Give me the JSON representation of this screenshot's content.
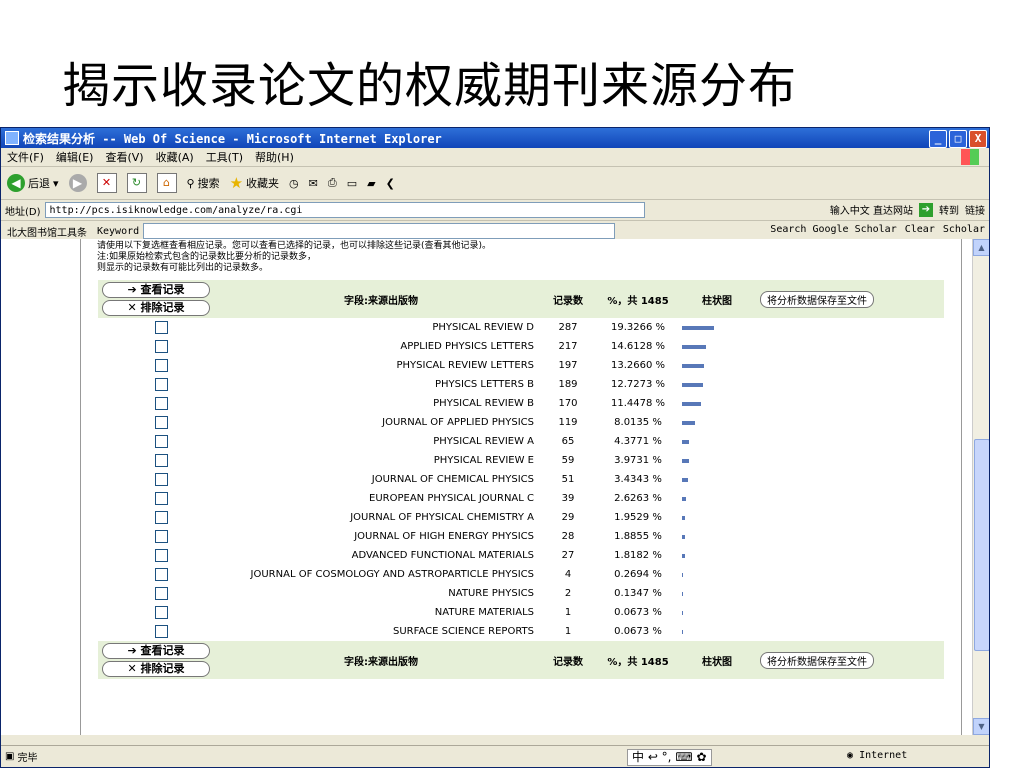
{
  "slide": {
    "title": "揭示收录论文的权威期刊来源分布"
  },
  "window": {
    "title": "检索结果分析 -- Web Of Science - Microsoft Internet Explorer",
    "controls": [
      "_",
      "□",
      "X"
    ]
  },
  "menu": [
    "文件(F)",
    "编辑(E)",
    "查看(V)",
    "收藏(A)",
    "工具(T)",
    "帮助(H)"
  ],
  "toolbar": {
    "back": "后退",
    "search": "搜索",
    "favorites": "收藏夹"
  },
  "address": {
    "label": "地址(D)",
    "url": "http://pcs.isiknowledge.com/analyze/ra.cgi",
    "hint": "输入中文 直达网站",
    "go": "转到",
    "links": "链接"
  },
  "libbar": {
    "label": "北大图书馆工具条",
    "keyword": "Keyword",
    "scholar": "Search Google Scholar",
    "clear": "Clear",
    "scholar2": "Scholar"
  },
  "notes": [
    "请使用以下复选框查看相应记录。您可以查看已选择的记录，也可以排除这些记录(查看其他记录)。",
    "注:如果原始检索式包含的记录数比要分析的记录数多，",
    "则显示的记录数有可能比列出的记录数多。"
  ],
  "table": {
    "view_btn": "➔ 查看记录",
    "exclude_btn": "✕ 排除记录",
    "field_header": "字段:来源出版物",
    "count_header": "记录数",
    "pct_header": "%，共 1485",
    "bar_header": "柱状图",
    "save_btn": "将分析数据保存至文件",
    "rows": [
      {
        "name": "PHYSICAL REVIEW D",
        "count": "287",
        "pct": "19.3266 %",
        "share": 19.3266
      },
      {
        "name": "APPLIED PHYSICS LETTERS",
        "count": "217",
        "pct": "14.6128 %",
        "share": 14.6128
      },
      {
        "name": "PHYSICAL REVIEW LETTERS",
        "count": "197",
        "pct": "13.2660 %",
        "share": 13.266
      },
      {
        "name": "PHYSICS LETTERS B",
        "count": "189",
        "pct": "12.7273 %",
        "share": 12.7273
      },
      {
        "name": "PHYSICAL REVIEW B",
        "count": "170",
        "pct": "11.4478 %",
        "share": 11.4478
      },
      {
        "name": "JOURNAL OF APPLIED PHYSICS",
        "count": "119",
        "pct": "8.0135 %",
        "share": 8.0135
      },
      {
        "name": "PHYSICAL REVIEW A",
        "count": "65",
        "pct": "4.3771 %",
        "share": 4.3771
      },
      {
        "name": "PHYSICAL REVIEW E",
        "count": "59",
        "pct": "3.9731 %",
        "share": 3.9731
      },
      {
        "name": "JOURNAL OF CHEMICAL PHYSICS",
        "count": "51",
        "pct": "3.4343 %",
        "share": 3.4343
      },
      {
        "name": "EUROPEAN PHYSICAL JOURNAL C",
        "count": "39",
        "pct": "2.6263 %",
        "share": 2.6263
      },
      {
        "name": "JOURNAL OF PHYSICAL CHEMISTRY A",
        "count": "29",
        "pct": "1.9529 %",
        "share": 1.9529
      },
      {
        "name": "JOURNAL OF HIGH ENERGY PHYSICS",
        "count": "28",
        "pct": "1.8855 %",
        "share": 1.8855
      },
      {
        "name": "ADVANCED FUNCTIONAL MATERIALS",
        "count": "27",
        "pct": "1.8182 %",
        "share": 1.8182
      },
      {
        "name": "JOURNAL OF COSMOLOGY AND ASTROPARTICLE PHYSICS",
        "count": "4",
        "pct": "0.2694 %",
        "share": 0.2694
      },
      {
        "name": "NATURE PHYSICS",
        "count": "2",
        "pct": "0.1347 %",
        "share": 0.1347
      },
      {
        "name": "NATURE MATERIALS",
        "count": "1",
        "pct": "0.0673 %",
        "share": 0.0673
      },
      {
        "name": "SURFACE SCIENCE REPORTS",
        "count": "1",
        "pct": "0.0673 %",
        "share": 0.0673
      }
    ]
  },
  "status": {
    "left": "完毕",
    "zone": "Internet",
    "ime": "中 ↩ °, ⌨ ✿"
  },
  "colors": {
    "bar": "#5878b8",
    "header_bg": "#e6f0d8",
    "titlebar": "#1045b8"
  }
}
